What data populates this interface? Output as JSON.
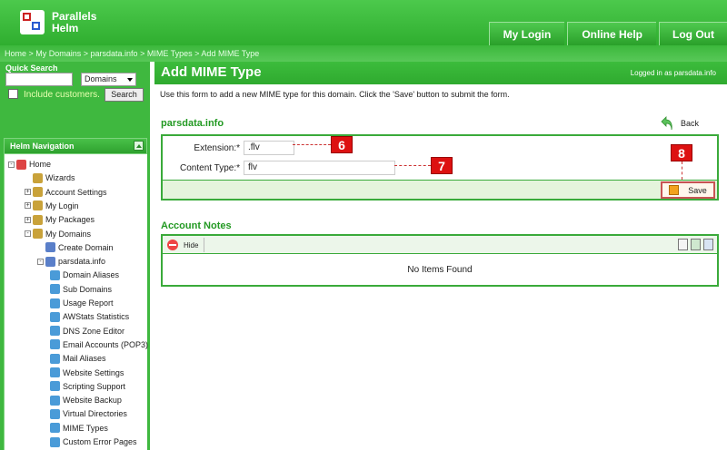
{
  "brand": {
    "line1": "Parallels",
    "line2": "Helm"
  },
  "top_nav": [
    {
      "label": "My Login"
    },
    {
      "label": "Online Help"
    },
    {
      "label": "Log Out"
    }
  ],
  "breadcrumb": "Home > My Domains > parsdata.info > MIME Types > Add MIME Type",
  "quick_search": {
    "title": "Quick Search",
    "input_value": "",
    "scope": "Domains",
    "include_label": "Include customers.",
    "search_button": "Search"
  },
  "nav": {
    "title": "Helm Navigation",
    "items": [
      {
        "label": "Home",
        "level": 0,
        "toggle": "-"
      },
      {
        "label": "Wizards",
        "level": 1,
        "toggle": ""
      },
      {
        "label": "Account Settings",
        "level": 1,
        "toggle": "+"
      },
      {
        "label": "My Login",
        "level": 1,
        "toggle": "+"
      },
      {
        "label": "My Packages",
        "level": 1,
        "toggle": "+"
      },
      {
        "label": "My Domains",
        "level": 1,
        "toggle": "-"
      },
      {
        "label": "Create Domain",
        "level": 2,
        "toggle": ""
      },
      {
        "label": "parsdata.info",
        "level": 2,
        "toggle": "-"
      },
      {
        "label": "Domain Aliases",
        "level": 3,
        "toggle": ""
      },
      {
        "label": "Sub Domains",
        "level": 3,
        "toggle": ""
      },
      {
        "label": "Usage Report",
        "level": 3,
        "toggle": ""
      },
      {
        "label": "AWStats Statistics",
        "level": 3,
        "toggle": ""
      },
      {
        "label": "DNS Zone Editor",
        "level": 3,
        "toggle": ""
      },
      {
        "label": "Email Accounts (POP3)",
        "level": 3,
        "toggle": ""
      },
      {
        "label": "Mail Aliases",
        "level": 3,
        "toggle": ""
      },
      {
        "label": "Website Settings",
        "level": 3,
        "toggle": ""
      },
      {
        "label": "Scripting Support",
        "level": 3,
        "toggle": ""
      },
      {
        "label": "Website Backup",
        "level": 3,
        "toggle": ""
      },
      {
        "label": "Virtual Directories",
        "level": 3,
        "toggle": ""
      },
      {
        "label": "MIME Types",
        "level": 3,
        "toggle": ""
      },
      {
        "label": "Custom Error Pages",
        "level": 3,
        "toggle": ""
      }
    ]
  },
  "page": {
    "title": "Add MIME Type",
    "logged_in": "Logged in as parsdata.info",
    "intro": "Use this form to add a new MIME type for this domain. Click the 'Save' button to submit the form.",
    "domain": "parsdata.info",
    "back_label": "Back",
    "extension_label": "Extension:*",
    "extension_value": ".flv",
    "content_type_label": "Content Type:*",
    "content_type_value": "flv",
    "save_label": "Save",
    "callouts": [
      "6",
      "7",
      "8"
    ]
  },
  "notes": {
    "title": "Account Notes",
    "hide_label": "Hide",
    "empty_text": "No Items Found"
  },
  "colors": {
    "accent": "#3ab53a",
    "callout": "#dd1111"
  }
}
